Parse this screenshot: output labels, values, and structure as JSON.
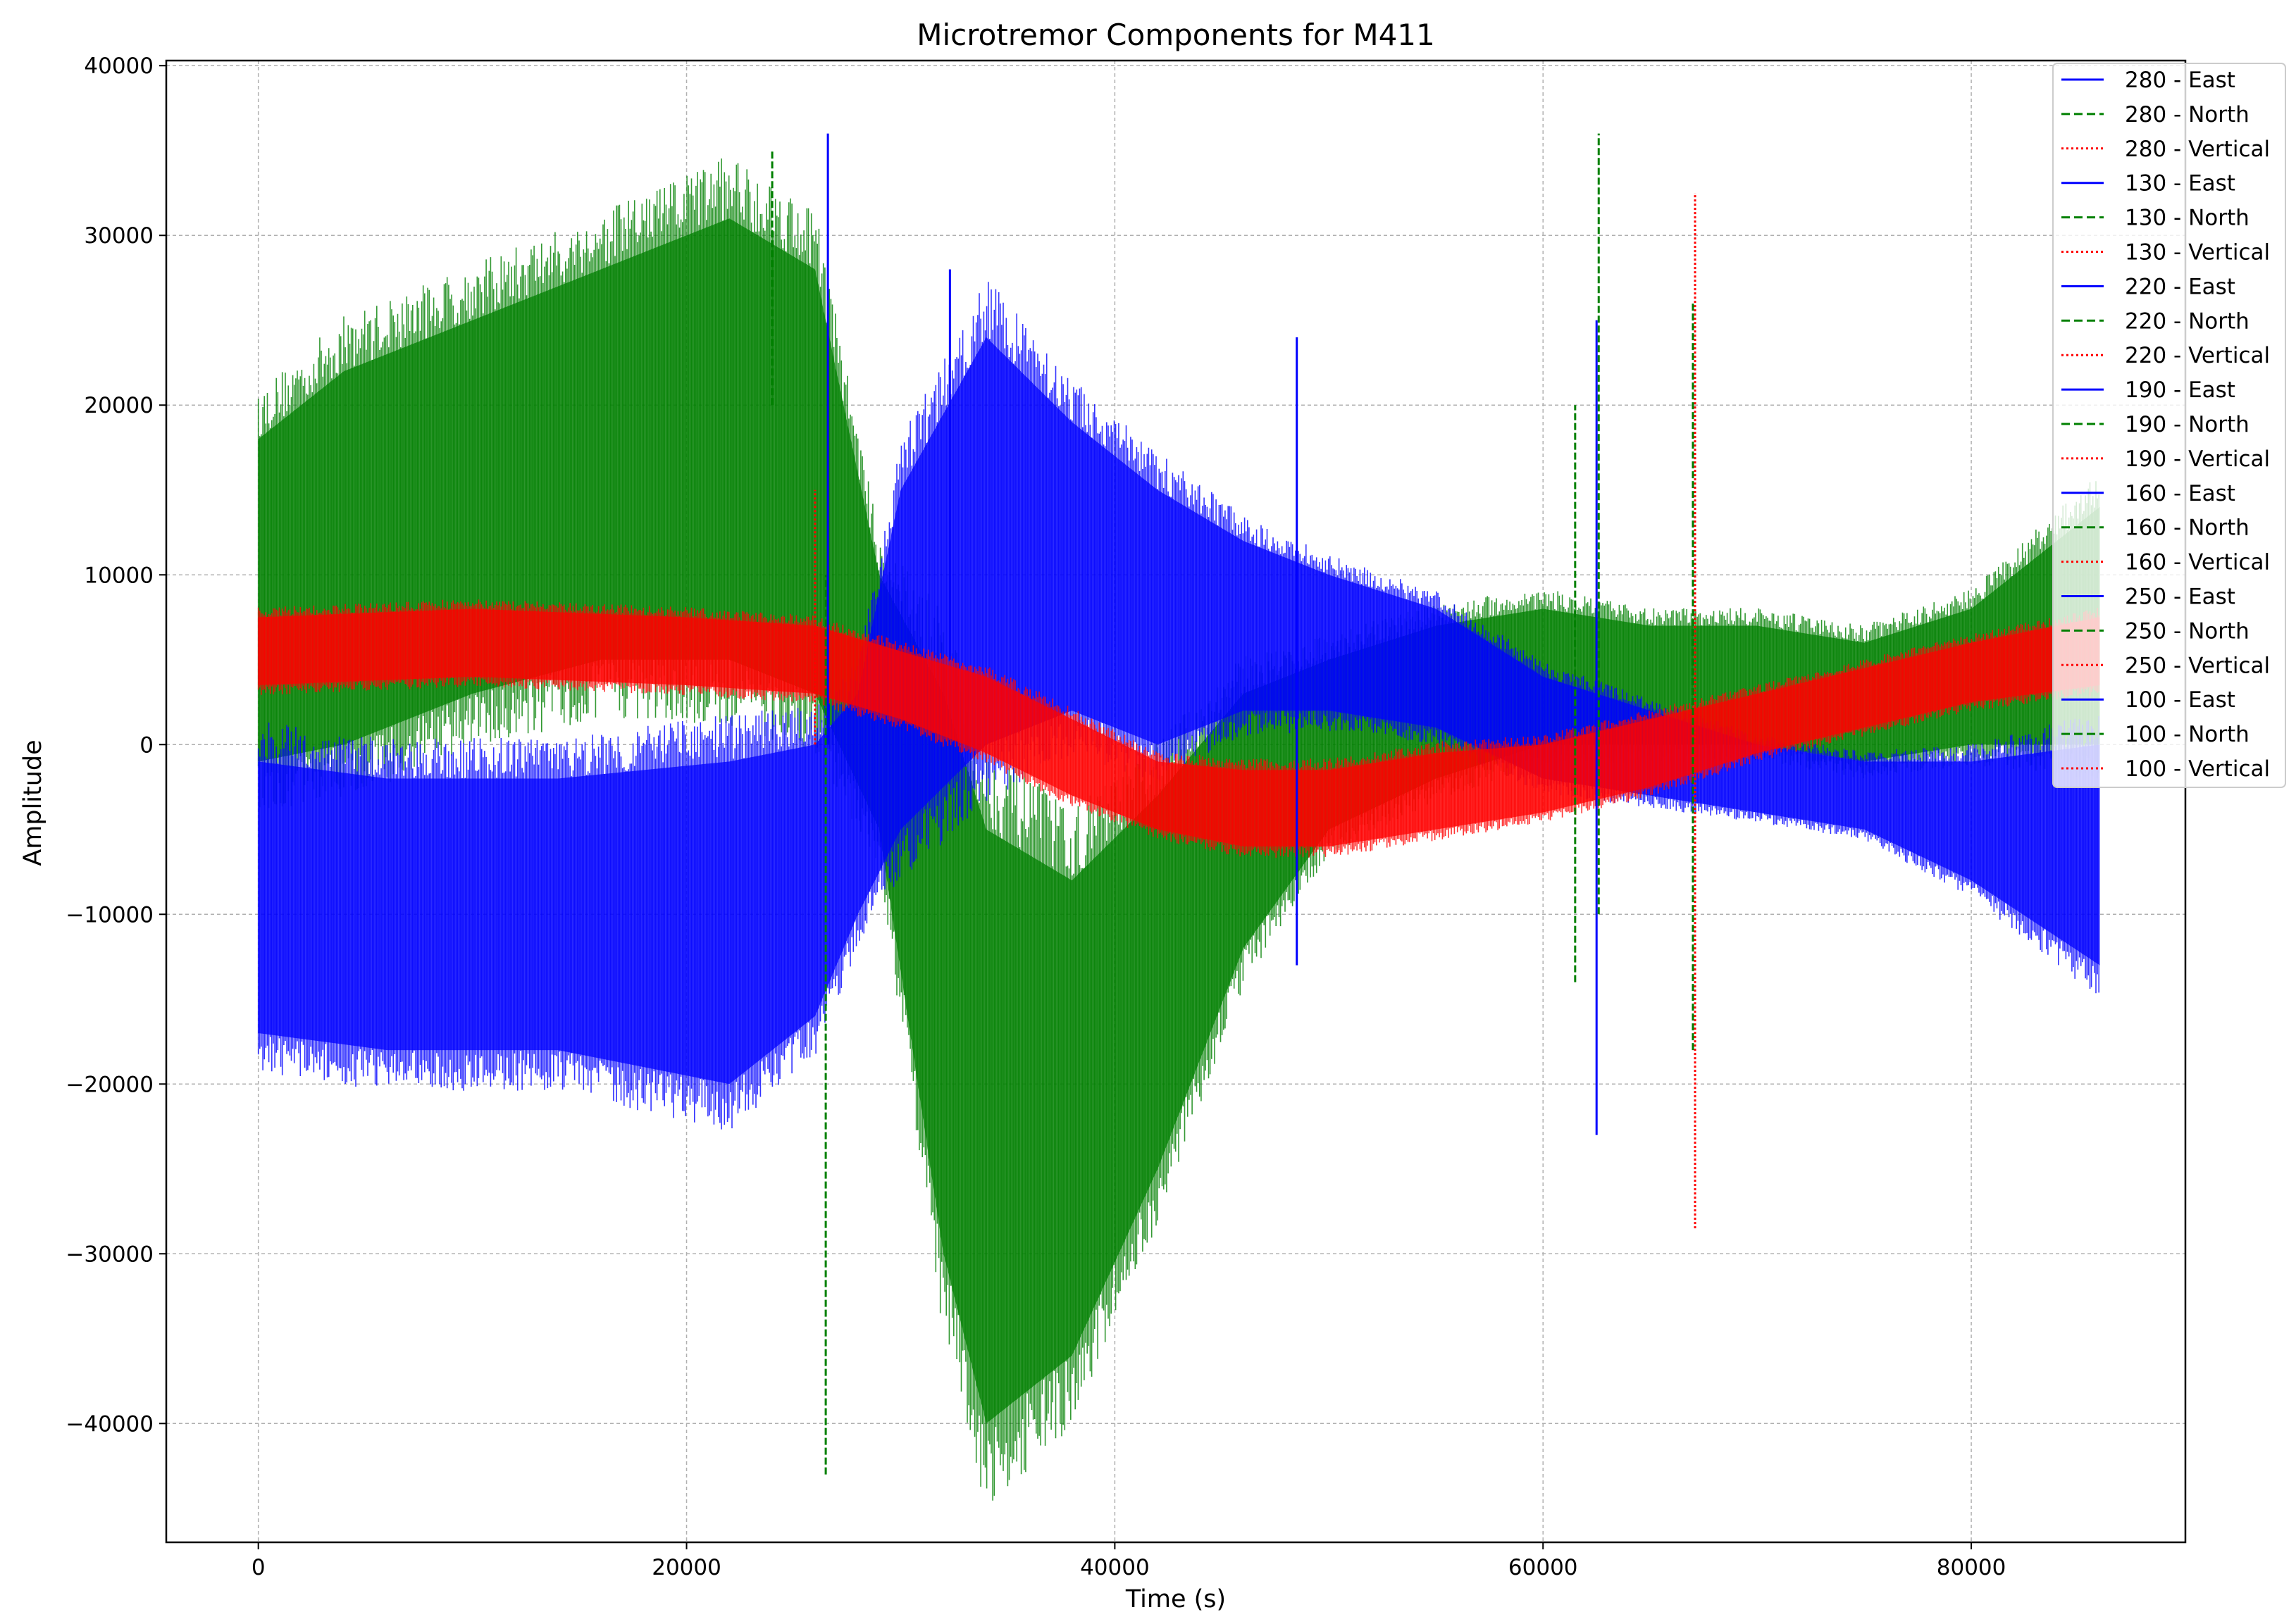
{
  "chart_data": {
    "type": "line",
    "title": "Microtremor Components for M411",
    "xlabel": "Time (s)",
    "ylabel": "Amplitude",
    "xlim": [
      -4300,
      90000
    ],
    "ylim": [
      -47000,
      40300
    ],
    "xticks": [
      0,
      20000,
      40000,
      60000,
      80000
    ],
    "xtick_labels": [
      "0",
      "20000",
      "40000",
      "60000",
      "80000"
    ],
    "yticks": [
      -40000,
      -30000,
      -20000,
      -10000,
      0,
      10000,
      20000,
      30000,
      40000
    ],
    "ytick_labels": [
      "−40000",
      "−30000",
      "−20000",
      "−10000",
      "0",
      "10000",
      "20000",
      "30000",
      "40000"
    ],
    "grid": true,
    "legend_placement": "top-right",
    "colors": {
      "East": "#0000ff",
      "North": "#008000",
      "Vertical": "#ff0000"
    },
    "legend": [
      {
        "label": "280 - East",
        "component": "East"
      },
      {
        "label": "280 - North",
        "component": "North"
      },
      {
        "label": "280 - Vertical",
        "component": "Vertical"
      },
      {
        "label": "130 - East",
        "component": "East"
      },
      {
        "label": "130 - North",
        "component": "North"
      },
      {
        "label": "130 - Vertical",
        "component": "Vertical"
      },
      {
        "label": "220 - East",
        "component": "East"
      },
      {
        "label": "220 - North",
        "component": "North"
      },
      {
        "label": "220 - Vertical",
        "component": "Vertical"
      },
      {
        "label": "190 - East",
        "component": "East"
      },
      {
        "label": "190 - North",
        "component": "North"
      },
      {
        "label": "190 - Vertical",
        "component": "Vertical"
      },
      {
        "label": "160 - East",
        "component": "East"
      },
      {
        "label": "160 - North",
        "component": "North"
      },
      {
        "label": "160 - Vertical",
        "component": "Vertical"
      },
      {
        "label": "250 - East",
        "component": "East"
      },
      {
        "label": "250 - North",
        "component": "North"
      },
      {
        "label": "250 - Vertical",
        "component": "Vertical"
      },
      {
        "label": "100 - East",
        "component": "East"
      },
      {
        "label": "100 - North",
        "component": "North"
      },
      {
        "label": "100 - Vertical",
        "component": "Vertical"
      }
    ],
    "envelopes": [
      {
        "component": "North",
        "points": [
          [
            0,
            -1000,
            18000
          ],
          [
            4000,
            0,
            22000
          ],
          [
            10000,
            3000,
            25000
          ],
          [
            16000,
            5000,
            28000
          ],
          [
            22000,
            5000,
            31000
          ],
          [
            26000,
            3000,
            28000
          ],
          [
            29000,
            -5000,
            10000
          ],
          [
            32000,
            -30000,
            3000
          ],
          [
            34000,
            -40000,
            -5000
          ],
          [
            38000,
            -36000,
            -8000
          ],
          [
            42000,
            -25000,
            -3000
          ],
          [
            46000,
            -12000,
            3000
          ],
          [
            50000,
            -5000,
            5000
          ],
          [
            55000,
            -2000,
            7000
          ],
          [
            60000,
            0,
            8000
          ],
          [
            65000,
            0,
            7000
          ],
          [
            70000,
            0,
            7000
          ],
          [
            75000,
            -1000,
            6000
          ],
          [
            80000,
            0,
            8000
          ],
          [
            84000,
            0,
            12000
          ],
          [
            86000,
            0,
            14000
          ]
        ]
      },
      {
        "component": "East",
        "points": [
          [
            0,
            -17000,
            -1000
          ],
          [
            6000,
            -18000,
            -2000
          ],
          [
            14000,
            -18000,
            -2000
          ],
          [
            22000,
            -20000,
            -1000
          ],
          [
            26000,
            -16000,
            0
          ],
          [
            28000,
            -10000,
            3000
          ],
          [
            30000,
            -5000,
            15000
          ],
          [
            34000,
            0,
            24000
          ],
          [
            38000,
            2000,
            19000
          ],
          [
            42000,
            0,
            15000
          ],
          [
            46000,
            2000,
            12000
          ],
          [
            50000,
            2000,
            10000
          ],
          [
            55000,
            1000,
            8000
          ],
          [
            60000,
            -2000,
            4000
          ],
          [
            65000,
            -3000,
            2000
          ],
          [
            70000,
            -4000,
            0
          ],
          [
            75000,
            -5000,
            -1000
          ],
          [
            80000,
            -8000,
            -1000
          ],
          [
            86000,
            -13000,
            0
          ]
        ]
      },
      {
        "component": "Vertical",
        "points": [
          [
            0,
            3500,
            7500
          ],
          [
            10000,
            4000,
            8000
          ],
          [
            20000,
            3500,
            7500
          ],
          [
            26000,
            3000,
            7000
          ],
          [
            30000,
            1500,
            5500
          ],
          [
            34000,
            -500,
            4000
          ],
          [
            38000,
            -3000,
            1500
          ],
          [
            42000,
            -5000,
            -1000
          ],
          [
            46000,
            -6000,
            -1500
          ],
          [
            50000,
            -6000,
            -1500
          ],
          [
            55000,
            -5000,
            -500
          ],
          [
            60000,
            -4000,
            0
          ],
          [
            65000,
            -2500,
            1500
          ],
          [
            70000,
            -500,
            3000
          ],
          [
            75000,
            1000,
            4500
          ],
          [
            80000,
            2500,
            6000
          ],
          [
            86000,
            3500,
            7500
          ]
        ]
      }
    ],
    "spikes": [
      {
        "component": "North",
        "x": 24000,
        "y0": 20000,
        "y1": 35000
      },
      {
        "component": "North",
        "x": 26500,
        "y0": -43000,
        "y1": 10000
      },
      {
        "component": "East",
        "x": 26600,
        "y0": 0,
        "y1": 36000
      },
      {
        "component": "East",
        "x": 32300,
        "y0": 5000,
        "y1": 28000
      },
      {
        "component": "East",
        "x": 48500,
        "y0": -13000,
        "y1": 24000
      },
      {
        "component": "North",
        "x": 61500,
        "y0": -14000,
        "y1": 20000
      },
      {
        "component": "East",
        "x": 62500,
        "y0": -23000,
        "y1": 25000
      },
      {
        "component": "North",
        "x": 62600,
        "y0": -10000,
        "y1": 36000
      },
      {
        "component": "North",
        "x": 67000,
        "y0": -18000,
        "y1": 26000
      },
      {
        "component": "Vertical",
        "x": 67100,
        "y0": -28500,
        "y1": 32500
      },
      {
        "component": "Vertical",
        "x": 26000,
        "y0": 0,
        "y1": 15000
      }
    ]
  }
}
